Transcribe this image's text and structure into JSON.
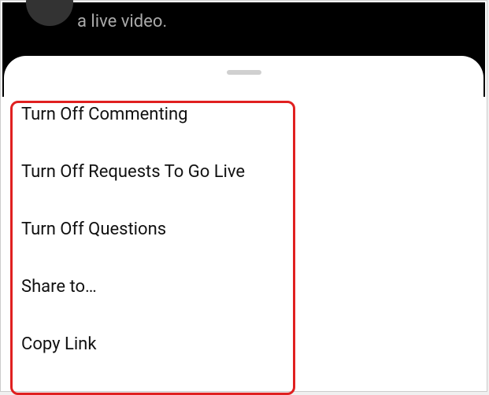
{
  "background": {
    "partial_text": "a live video."
  },
  "sheet": {
    "menu_items": [
      {
        "label": "Turn Off Commenting"
      },
      {
        "label": "Turn Off Requests To Go Live"
      },
      {
        "label": "Turn Off Questions"
      },
      {
        "label": "Share to…"
      },
      {
        "label": "Copy Link"
      }
    ]
  },
  "highlight": {
    "color": "#e02020"
  }
}
